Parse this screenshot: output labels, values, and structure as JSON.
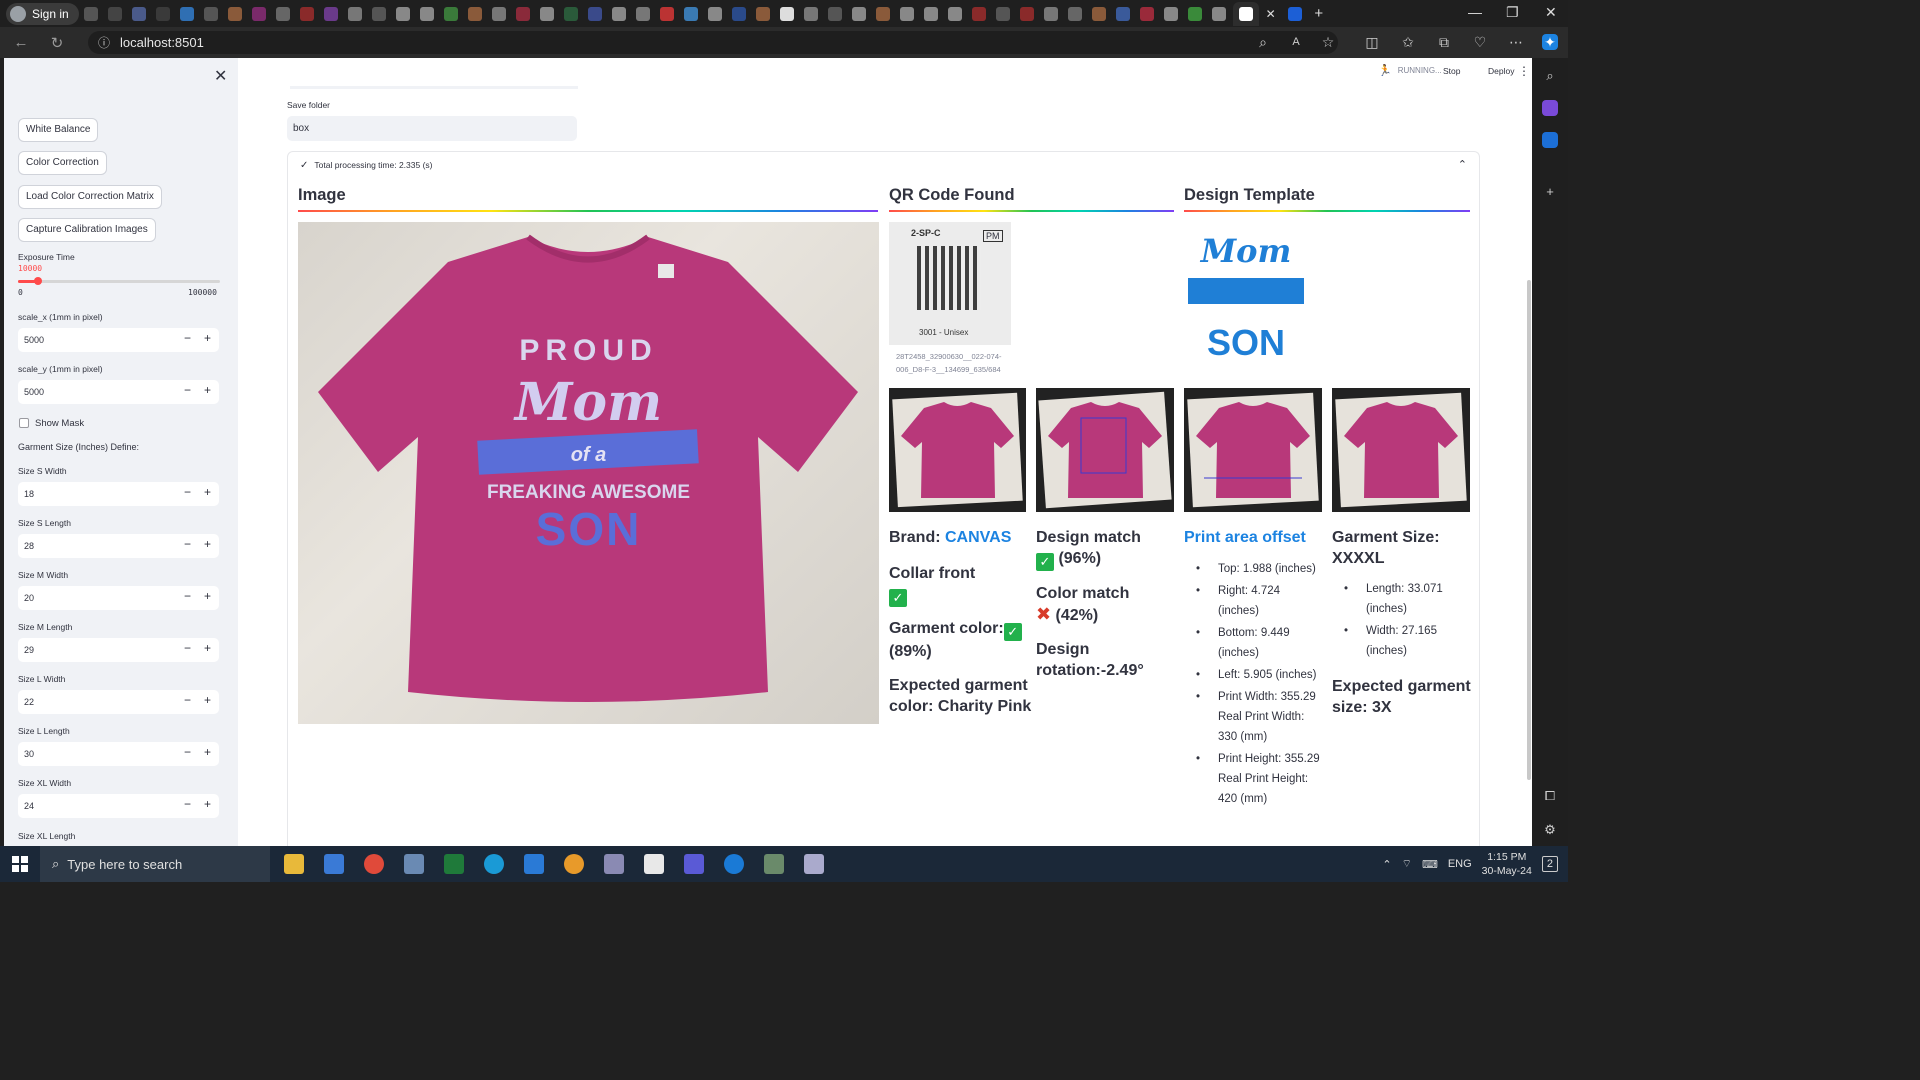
{
  "browser": {
    "profile_label": "Sign in",
    "url": "localhost:8501",
    "window_controls": {
      "minimize": "—",
      "restore": "❐",
      "close": "✕"
    }
  },
  "header": {
    "status_text": "RUNNING...",
    "stop_label": "Stop",
    "deploy_label": "Deploy",
    "menu_icon": "⋮"
  },
  "sidebar": {
    "close_icon": "✕",
    "buttons": [
      "White Balance",
      "Color Correction",
      "Load Color Correction Matrix",
      "Capture Calibration Images"
    ],
    "exposure": {
      "label": "Exposure Time",
      "value": "10000",
      "min": "0",
      "max": "100000",
      "fraction": 0.1
    },
    "scale_x": {
      "label": "scale_x (1mm in pixel)",
      "value": "5000"
    },
    "scale_y": {
      "label": "scale_y (1mm in pixel)",
      "value": "5000"
    },
    "show_mask_label": "Show Mask",
    "garment_section_label": "Garment Size (Inches) Define:",
    "sizes": [
      {
        "label": "Size S Width",
        "value": "18"
      },
      {
        "label": "Size S Length",
        "value": "28"
      },
      {
        "label": "Size M Width",
        "value": "20"
      },
      {
        "label": "Size M Length",
        "value": "29"
      },
      {
        "label": "Size L Width",
        "value": "22"
      },
      {
        "label": "Size L Length",
        "value": "30"
      },
      {
        "label": "Size XL Width",
        "value": "24"
      }
    ],
    "trailing_label": "Size XL Length",
    "minus": "−",
    "plus": "+"
  },
  "main": {
    "save_folder_label": "Save folder",
    "save_folder_value": "box",
    "expander_title": "Total processing time: 2.335 (s)",
    "columns": {
      "image": "Image",
      "qr": "QR Code Found",
      "template": "Design Template"
    },
    "qr_caption": "28T2458_32900630__022-074-006_D8-F-3__134699_635/684",
    "qr_label_texts": [
      "2-SP-C",
      "PM",
      "3001 - Unisex"
    ],
    "template_text": {
      "line1": "Mom",
      "line2": "SON"
    },
    "shirt_print": {
      "proud": "PROUD",
      "mom": "Mom",
      "ofa": "of a",
      "freaking": "FREAKING AWESOME",
      "son": "SON"
    },
    "brand": {
      "label": "Brand: ",
      "value": "CANVAS"
    },
    "collar_front": "Collar front",
    "garment_color": {
      "label": "Garment color:",
      "percent": "(89%)"
    },
    "expected_color": "Expected garment color: Charity Pink",
    "design_match": {
      "label": "Design match",
      "percent": "(96%)"
    },
    "color_match": {
      "label": "Color match",
      "percent": "(42%)"
    },
    "design_rotation": "Design rotation:-2.49°",
    "print_area_title": "Print area offset",
    "print_area": [
      "Top: 1.988 (inches)",
      "Right: 4.724 (inches)",
      "Bottom: 9.449 (inches)",
      "Left: 5.905 (inches)",
      "Print Width: 355.29 Real Print Width: 330 (mm)",
      "Print Height: 355.29 Real Print Height: 420 (mm)"
    ],
    "garment_size_title": "Garment Size: XXXXL",
    "garment_size": [
      "Length: 33.071 (inches)",
      "Width: 27.165 (inches)"
    ],
    "expected_size": "Expected garment size: 3X"
  },
  "taskbar": {
    "search_placeholder": "Type here to search",
    "lang": "ENG",
    "time": "1:15 PM",
    "date": "30-May-24",
    "notif_count": "2"
  },
  "colors": {
    "accent": "#ff4b4b",
    "shirt": "#b8387a",
    "link": "#1c83e1",
    "check": "#22b14c"
  }
}
